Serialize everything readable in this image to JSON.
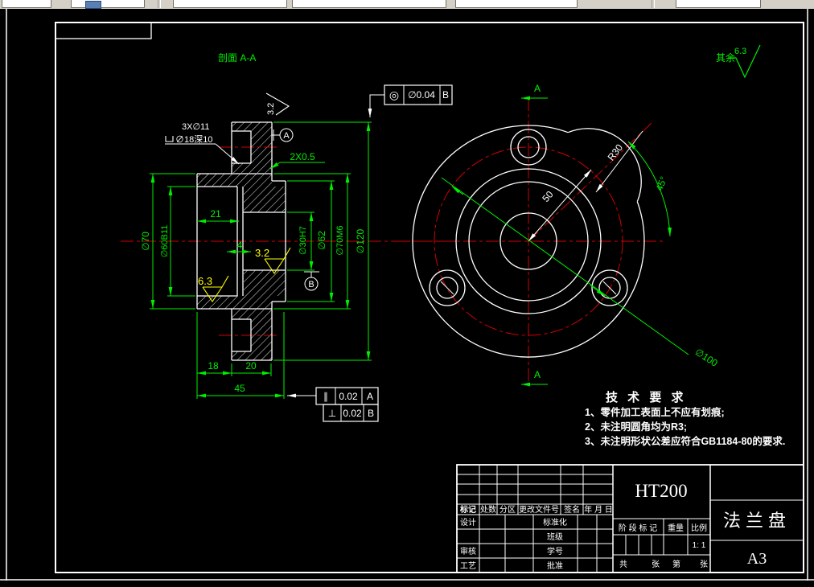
{
  "sheet": {
    "section_title": "剖面 A-A",
    "others_label": "其余",
    "others_roughness": "6.3"
  },
  "left_view": {
    "holes_note_line1": "3X∅11",
    "holes_note_line2": "∅18深10",
    "chamfer_note": "2X0.5",
    "rough_top": "3.2",
    "rough_bore": "3.2",
    "rough_face": "6.3",
    "dims": {
      "width_21": "21",
      "width_4": "4",
      "width_18": "18",
      "width_20": "20",
      "width_45": "45",
      "dia70": "∅70",
      "dia60": "∅60B11",
      "dia30": "∅30H7",
      "dia62": "∅62",
      "dia70m6": "∅70M6",
      "dia120": "∅120"
    },
    "fcf_concentric": {
      "symbol": "◎",
      "value": "∅0.04",
      "datum": "B"
    },
    "fcf_parallel": {
      "symbol": "∥",
      "value": "0.02",
      "datum": "A"
    },
    "fcf_perpendicular": {
      "symbol": "⊥",
      "value": "0.02",
      "datum": "B"
    },
    "datum_a": "A",
    "datum_b": "B"
  },
  "right_view": {
    "radius_r30": "R30",
    "dim_50": "50",
    "angle": "45°",
    "bolt_circle": "∅100",
    "section_label_top": "A",
    "section_label_bottom": "A"
  },
  "tech_requirements": {
    "title": "技 术 要 求",
    "items": [
      "1、零件加工表面上不应有划痕;",
      "2、未注明圆角均为R3;",
      "3、未注明形状公差应符合GB1184-80的要求."
    ]
  },
  "title_block": {
    "material": "HT200",
    "part_name": "法兰盘",
    "paper_size": "A3",
    "header_cells": [
      "标记",
      "处数",
      "分区",
      "更改文件号",
      "签名",
      "年 月 日"
    ],
    "designer_label": "设计",
    "checker_label": "审核",
    "process_label": "工艺",
    "standardization_label": "标准化",
    "class_label": "班级",
    "student_no_label": "学号",
    "approve_label": "批准",
    "stage_mark_label": "阶 段 标 记",
    "weight_label": "重量",
    "scale_label": "比例",
    "scale_value": "1: 1",
    "total_label": "共",
    "total_unit": "张",
    "page_label": "第",
    "page_unit": "张"
  },
  "colors": {
    "dim_green": "#00ef00",
    "center_red": "#d40000",
    "rough_yellow": "#ffff00",
    "line_white": "#ffffff",
    "toolbar_gray": "#d4d0c8"
  }
}
